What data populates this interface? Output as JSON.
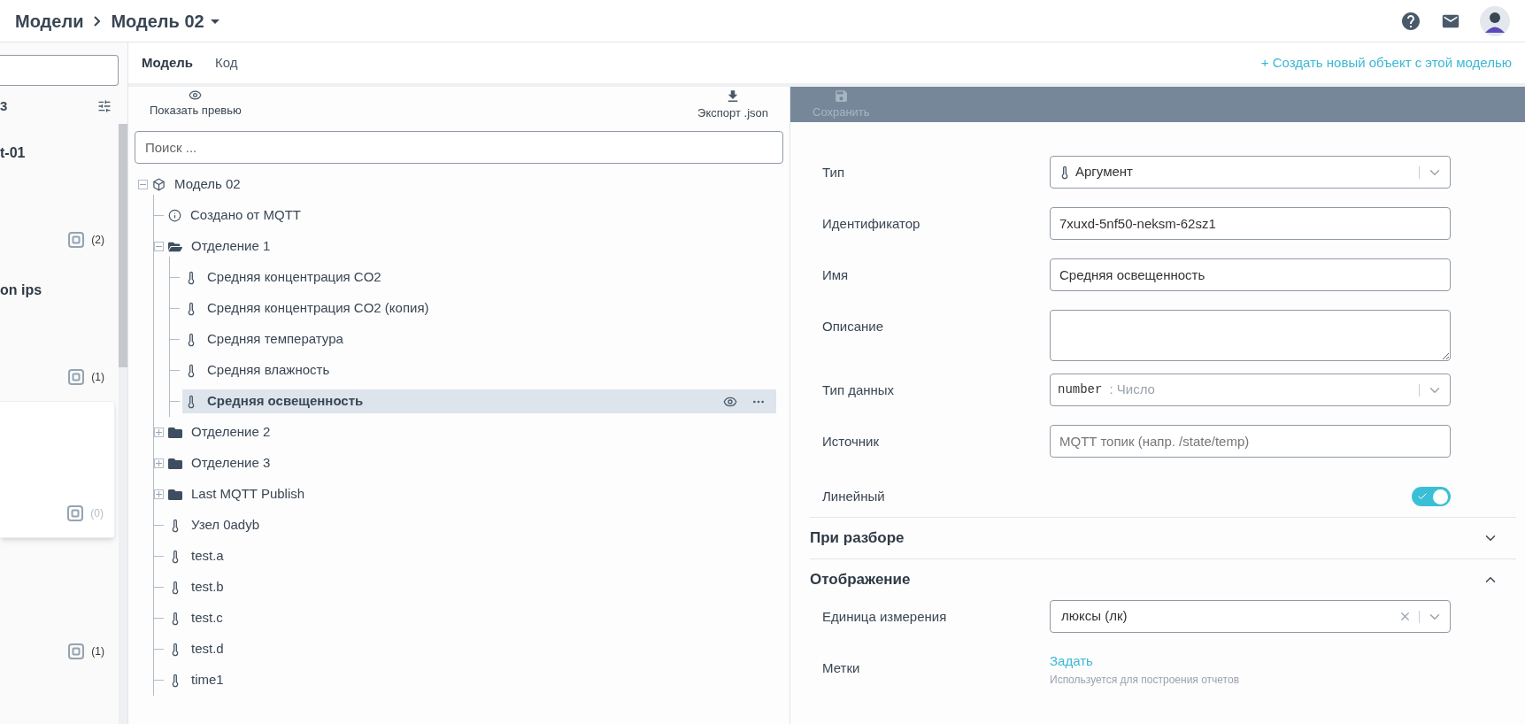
{
  "header": {
    "breadcrumbs": [
      {
        "label": "Модели"
      },
      {
        "label": "Модель 02"
      }
    ]
  },
  "left_list": {
    "count_label": "3",
    "items": [
      {
        "title": "t-01",
        "count": "(2)",
        "selected": false,
        "muted": false
      },
      {
        "title": "on ips",
        "count": "(1)",
        "selected": false,
        "muted": false
      },
      {
        "count": "(0)",
        "selected": true,
        "muted": true
      },
      {
        "count": "(1)",
        "selected": false,
        "muted": false
      }
    ]
  },
  "tabs": [
    {
      "label": "Модель",
      "selected": true
    },
    {
      "label": "Код",
      "selected": false
    }
  ],
  "create_link": "+ Создать новый объект с этой моделью",
  "tree_toolbar": {
    "preview": "Показать превью",
    "export": "Экспорт .json"
  },
  "tree_search": {
    "placeholder": "Поиск ..."
  },
  "tree": [
    {
      "label": "Модель 02",
      "kind": "model",
      "expanded": true,
      "selected": false,
      "children": [
        {
          "label": "Создано от MQTT",
          "kind": "info",
          "selected": false
        },
        {
          "label": "Отделение 1",
          "kind": "folder",
          "expanded": true,
          "selected": false,
          "children": [
            {
              "label": "Средняя концентрация CO2",
              "kind": "argument",
              "selected": false
            },
            {
              "label": "Средняя концентрация CO2 (копия)",
              "kind": "argument",
              "selected": false
            },
            {
              "label": "Средняя температура",
              "kind": "argument",
              "selected": false
            },
            {
              "label": "Средняя влажность",
              "kind": "argument",
              "selected": false
            },
            {
              "label": "Средняя освещенность",
              "kind": "argument",
              "selected": true
            }
          ]
        },
        {
          "label": "Отделение 2",
          "kind": "folder",
          "expanded": false,
          "selected": false
        },
        {
          "label": "Отделение 3",
          "kind": "folder",
          "expanded": false,
          "selected": false
        },
        {
          "label": "Last MQTT Publish",
          "kind": "folder",
          "expanded": false,
          "selected": false
        },
        {
          "label": "Узел 0adyb",
          "kind": "argument",
          "selected": false
        },
        {
          "label": "test.a",
          "kind": "argument",
          "selected": false
        },
        {
          "label": "test.b",
          "kind": "argument",
          "selected": false
        },
        {
          "label": "test.c",
          "kind": "argument",
          "selected": false
        },
        {
          "label": "test.d",
          "kind": "argument",
          "selected": false
        },
        {
          "label": "time1",
          "kind": "argument",
          "selected": false
        }
      ]
    }
  ],
  "form_toolbar": {
    "save": "Сохранить",
    "disabled": true
  },
  "form": [
    {
      "kind": "icon_select",
      "label": "Тип",
      "value": "Аргумент"
    },
    {
      "kind": "input",
      "label": "Идентификатор",
      "value": "7xuxd-5nf50-neksm-62sz1"
    },
    {
      "kind": "input",
      "label": "Имя",
      "value": "Средняя освещенность"
    },
    {
      "kind": "textarea",
      "label": "Описание"
    },
    {
      "kind": "select",
      "label": "Тип данных",
      "code": "number",
      "value": ": Число"
    },
    {
      "kind": "input",
      "label": "Источник",
      "placeholder": "MQTT топик (напр. /state/temp)"
    },
    {
      "kind": "toggle",
      "label": "Линейный",
      "on": true
    }
  ],
  "sections": [
    {
      "title": "При разборе",
      "expanded": false
    },
    {
      "title": "Отображение",
      "expanded": true,
      "fields": [
        {
          "kind": "select",
          "label": "Единица измерения",
          "value": "люксы (лк)",
          "clearable": true
        },
        {
          "kind": "link",
          "label": "Метки",
          "link": "Задать",
          "hint": "Используется для построения отчетов"
        }
      ]
    }
  ]
}
